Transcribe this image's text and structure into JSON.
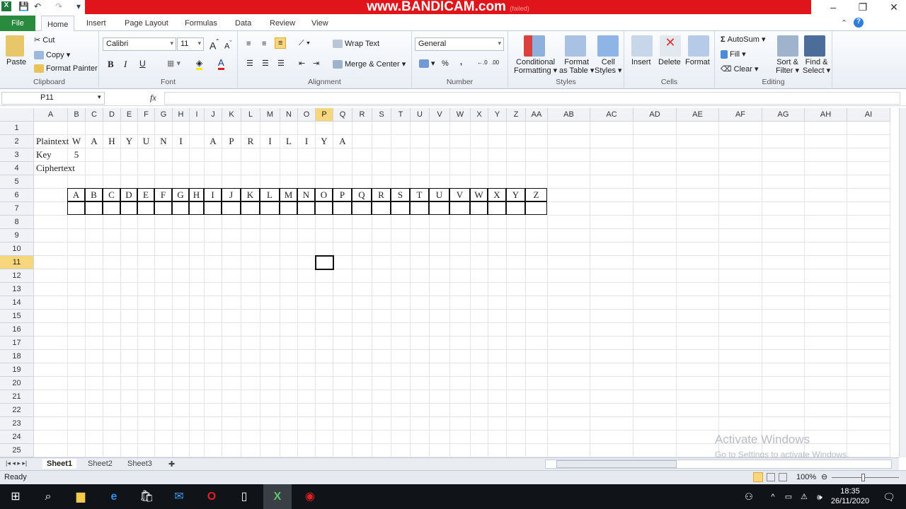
{
  "window": {
    "watermark": "www.BANDICAM.com",
    "title_hint": "(failed)"
  },
  "tabs": [
    "File",
    "Home",
    "Insert",
    "Page Layout",
    "Formulas",
    "Data",
    "Review",
    "View"
  ],
  "ribbon": {
    "clipboard": {
      "label": "Clipboard",
      "paste": "Paste",
      "cut": "Cut",
      "copy": "Copy",
      "format_painter": "Format Painter"
    },
    "font": {
      "label": "Font",
      "name": "Calibri",
      "size": "11",
      "bold": "B",
      "italic": "I",
      "underline": "U"
    },
    "alignment": {
      "label": "Alignment",
      "wrap": "Wrap Text",
      "merge": "Merge & Center"
    },
    "number": {
      "label": "Number",
      "format": "General",
      "percent": "%",
      "comma": ","
    },
    "styles": {
      "label": "Styles",
      "conditional": [
        "Conditional",
        "Formatting ▾"
      ],
      "table": [
        "Format",
        "as Table ▾"
      ],
      "cell": [
        "Cell",
        "Styles ▾"
      ]
    },
    "cells": {
      "label": "Cells",
      "insert": "Insert",
      "delete": "Delete",
      "format": "Format"
    },
    "editing": {
      "label": "Editing",
      "autosum": "AutoSum ▾",
      "fill": "Fill ▾",
      "clear": "Clear ▾",
      "sort": [
        "Sort &",
        "Filter ▾"
      ],
      "find": [
        "Find &",
        "Select ▾"
      ]
    }
  },
  "formula_bar": {
    "name_box": "P11",
    "fx": "fx",
    "formula": ""
  },
  "grid": {
    "columns": [
      "A",
      "B",
      "C",
      "D",
      "E",
      "F",
      "G",
      "H",
      "I",
      "J",
      "K",
      "L",
      "M",
      "N",
      "O",
      "P",
      "Q",
      "R",
      "S",
      "T",
      "U",
      "V",
      "W",
      "X",
      "Y",
      "Z",
      "AA",
      "AB",
      "AC",
      "AD",
      "AE",
      "AF",
      "AG",
      "AH",
      "AI"
    ],
    "rows": 25,
    "selected_cell": "P11",
    "row_labels": {
      "2": "Plaintext",
      "3": "Key",
      "4": "Ciphertext"
    },
    "plaintext": [
      "W",
      "A",
      "H",
      "Y",
      "U",
      "N",
      "I",
      "",
      "A",
      "P",
      "R",
      "I",
      "L",
      "I",
      "Y",
      "A"
    ],
    "key": "5",
    "alphabet": [
      "A",
      "B",
      "C",
      "D",
      "E",
      "F",
      "G",
      "H",
      "I",
      "J",
      "K",
      "L",
      "M",
      "N",
      "O",
      "P",
      "Q",
      "R",
      "S",
      "T",
      "U",
      "V",
      "W",
      "X",
      "Y",
      "Z"
    ]
  },
  "sheets": [
    "Sheet1",
    "Sheet2",
    "Sheet3"
  ],
  "active_sheet": "Sheet1",
  "status": {
    "text": "Ready",
    "zoom": "100%"
  },
  "activate": {
    "title": "Activate Windows",
    "subtitle": "Go to Settings to activate Windows."
  },
  "taskbar": {
    "time": "18:35",
    "date": "26/11/2020"
  }
}
